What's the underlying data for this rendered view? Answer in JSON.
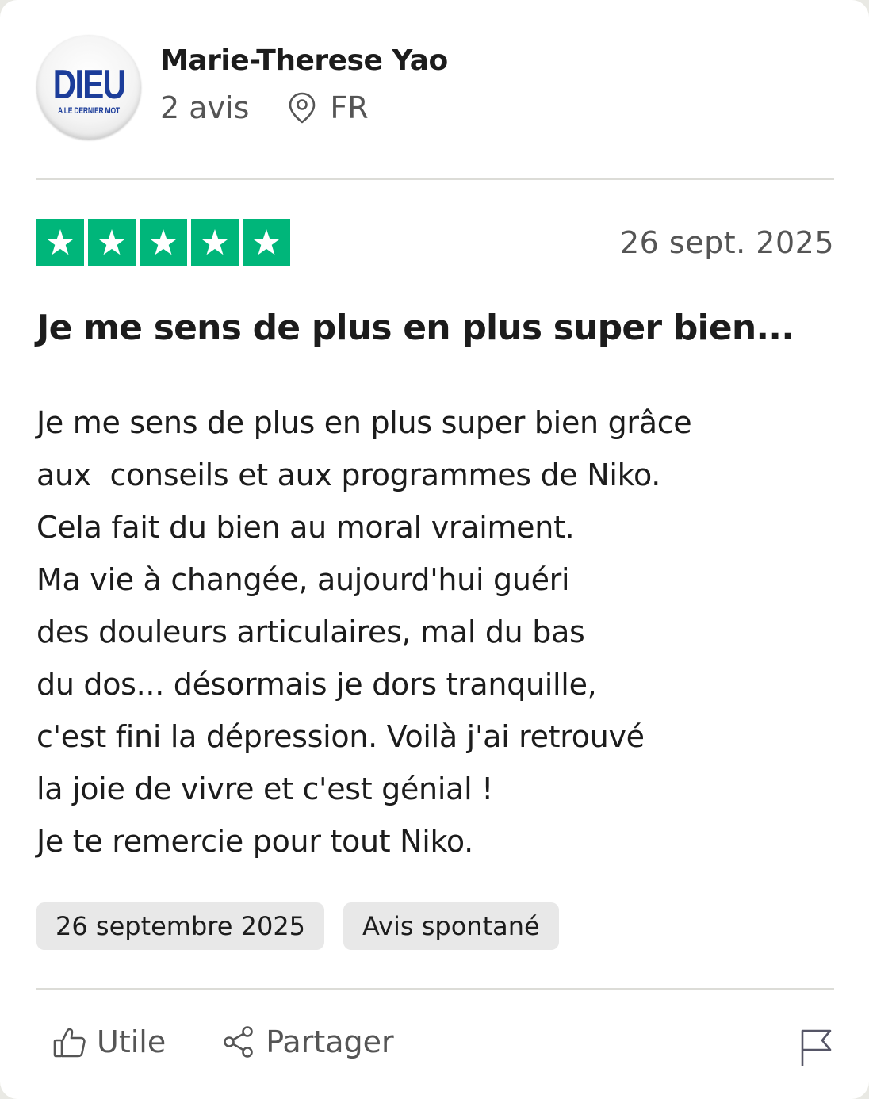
{
  "reviewer": {
    "avatar": {
      "main_text": "DIEU",
      "sub_text": "A LE DERNIER MOT"
    },
    "name": "Marie-Therese Yao",
    "review_count": "2 avis",
    "location": "FR",
    "location_icon": "map-pin-icon"
  },
  "review": {
    "rating": 5,
    "rating_max": 5,
    "star_color": "#00b67a",
    "date": "26 sept. 2025",
    "title": "Je me sens de plus en plus super bien...",
    "body_lines": [
      "Je me sens de plus en plus super bien grâce",
      "aux  conseils et aux programmes de Niko.",
      "Cela fait du bien au moral vraiment.",
      "Ma vie à changée, aujourd'hui guéri",
      "des douleurs articulaires, mal du bas",
      "du dos... désormais je dors tranquille,",
      "c'est fini la dépression. Voilà j'ai retrouvé",
      "la joie de vivre et c'est génial !",
      "Je te remercie pour tout Niko."
    ],
    "tags": [
      "26 septembre 2025",
      "Avis spontané"
    ]
  },
  "actions": {
    "useful_label": "Utile",
    "useful_icon": "thumbs-up-icon",
    "share_label": "Partager",
    "share_icon": "share-icon",
    "report_icon": "flag-icon"
  }
}
